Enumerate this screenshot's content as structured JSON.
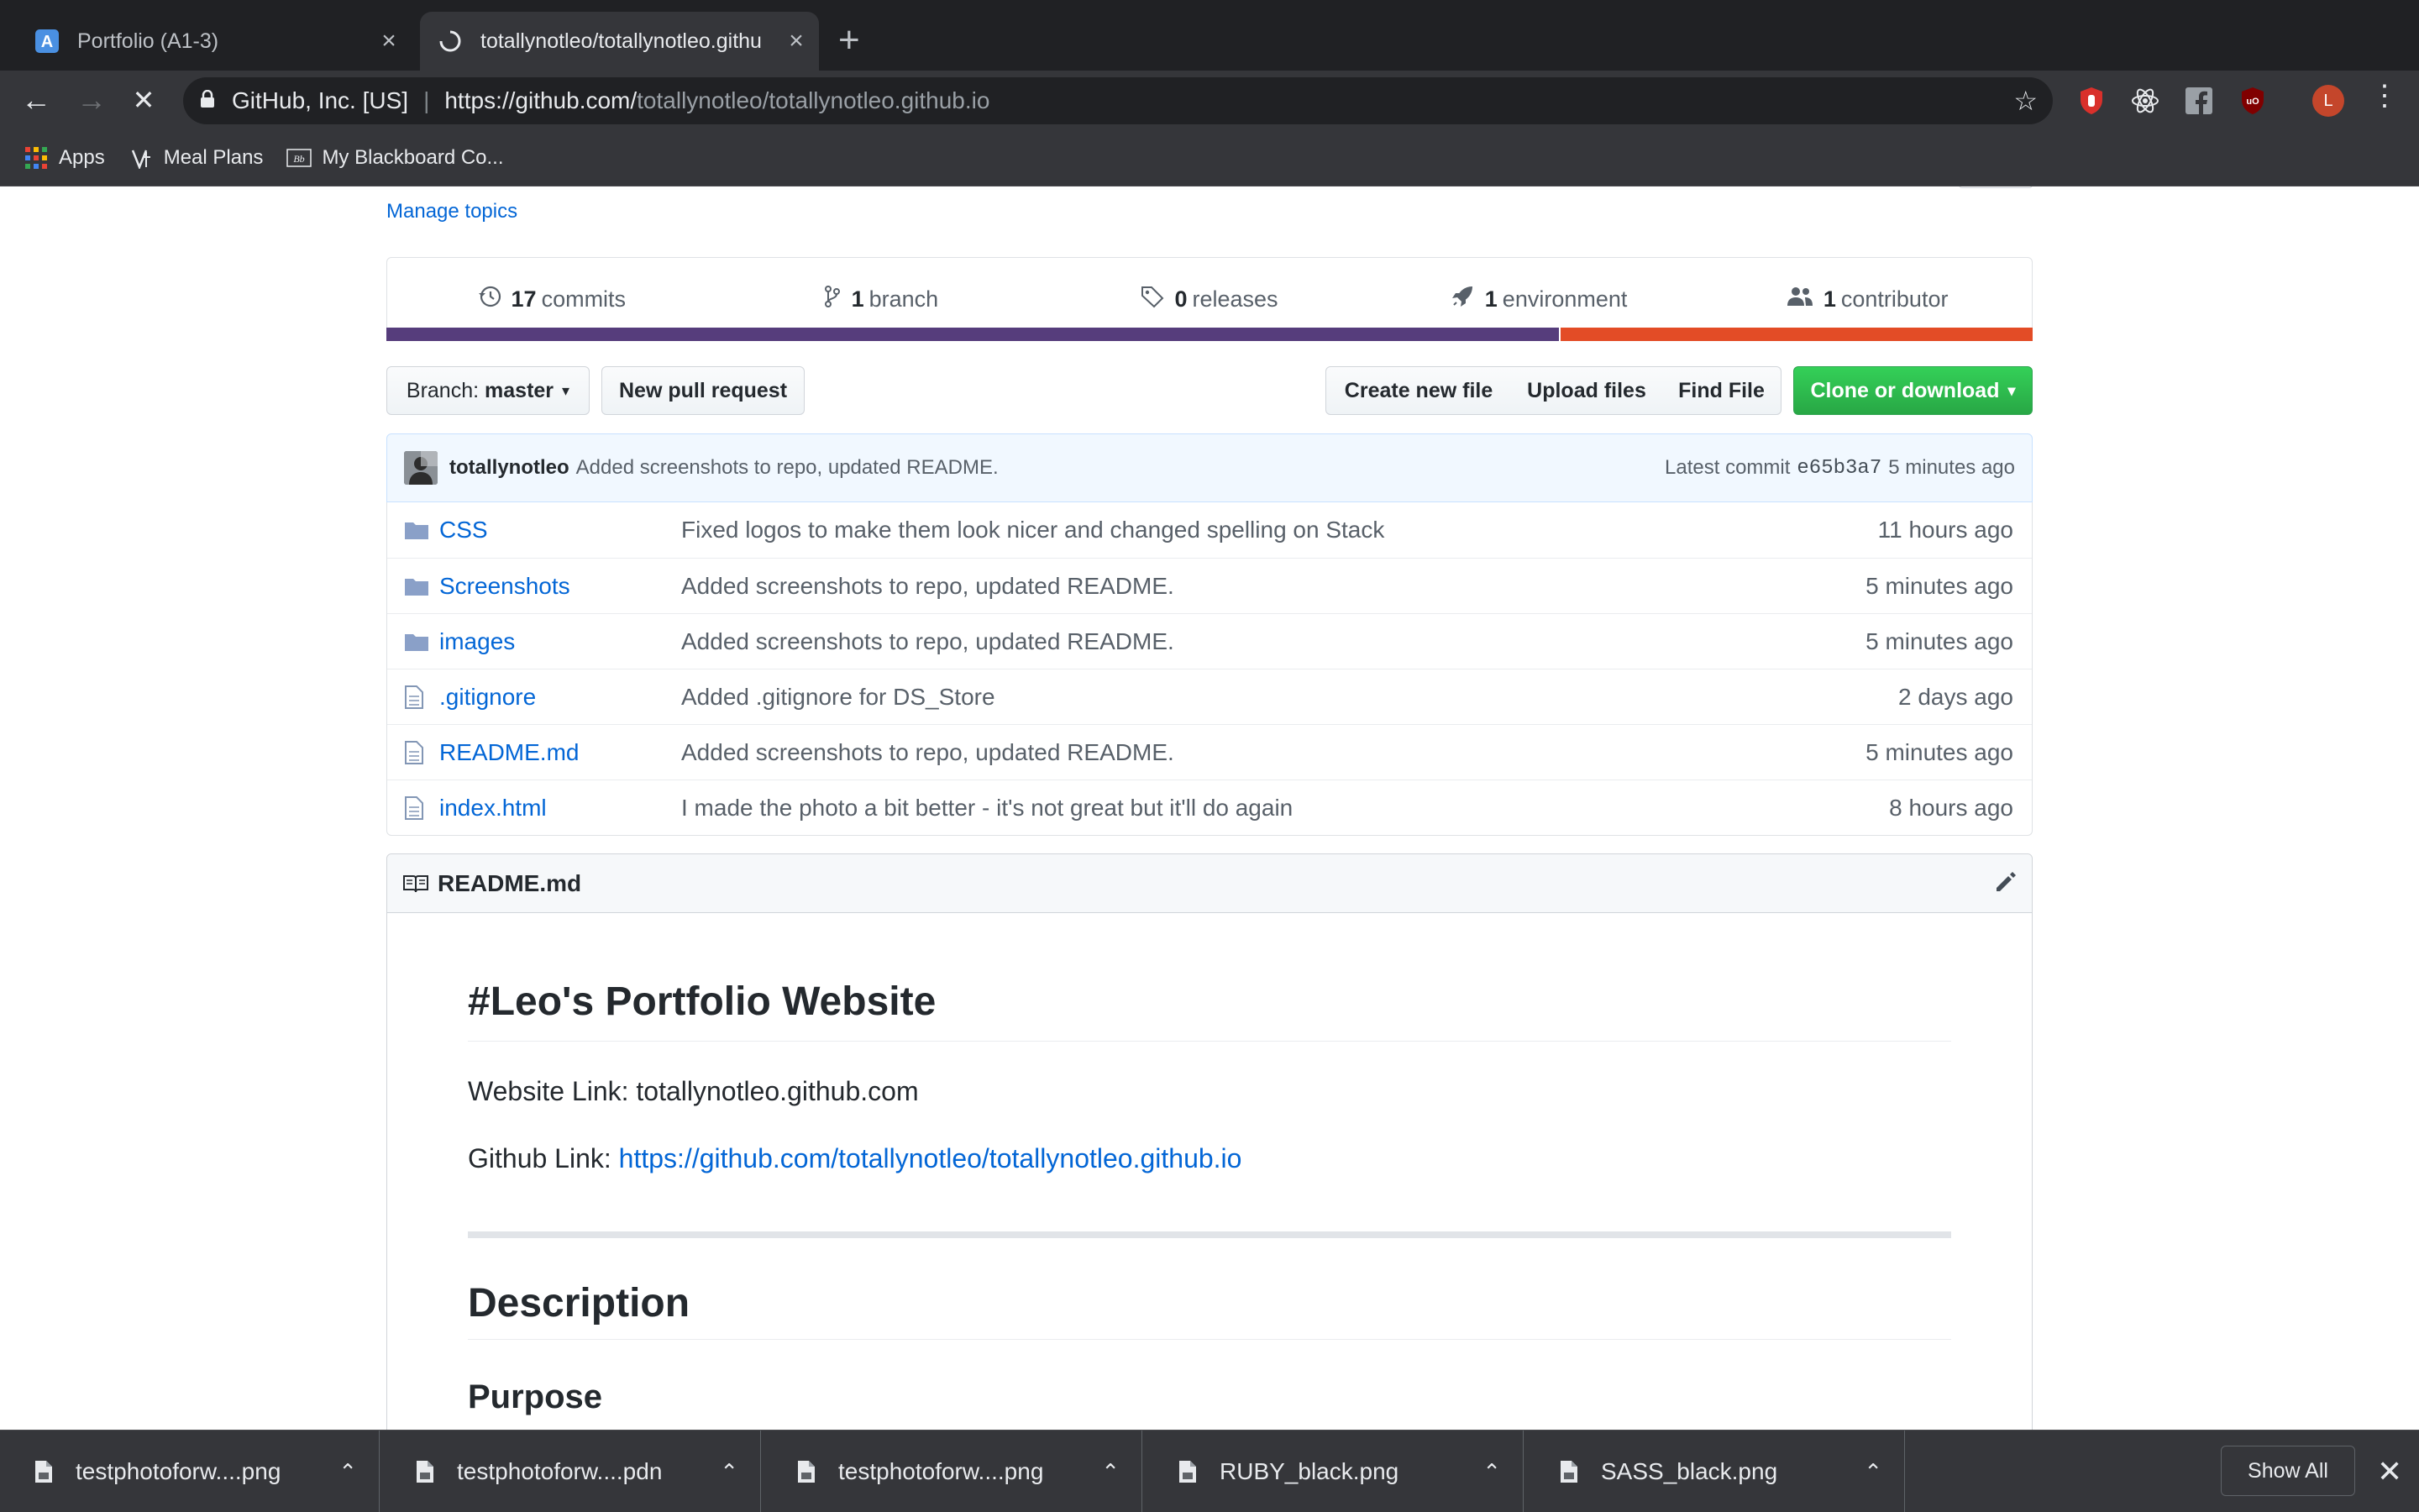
{
  "browser": {
    "tabs": [
      {
        "title": "Portfolio (A1-3)",
        "close": "×"
      },
      {
        "title": "totallynotleo/totallynotleo.githu",
        "close": "×"
      }
    ],
    "new_tab": "+",
    "back": "←",
    "forward": "→",
    "stop": "✕",
    "site_identity": "GitHub, Inc. [US]",
    "url_host": "https://github.com/",
    "url_path": "totallynotleo/totallynotleo.github.io",
    "star": "☆",
    "avatar_letter": "L",
    "menu": "⋮",
    "bookmarks": [
      {
        "label": "Apps"
      },
      {
        "label": "Meal Plans"
      },
      {
        "label": "My Blackboard Co..."
      }
    ]
  },
  "repo": {
    "manage_topics": "Manage topics",
    "stats": [
      {
        "count": "17",
        "label": "commits",
        "icon": "history-icon"
      },
      {
        "count": "1",
        "label": "branch",
        "icon": "branch-icon"
      },
      {
        "count": "0",
        "label": "releases",
        "icon": "tag-icon"
      },
      {
        "count": "1",
        "label": "environment",
        "icon": "rocket-icon"
      },
      {
        "count": "1",
        "label": "contributor",
        "icon": "people-icon"
      }
    ],
    "languages": [
      {
        "color": "#563d7c",
        "fraction": 0.712
      },
      {
        "color": "#e34c26",
        "fraction": 0.288
      }
    ],
    "branch_label": "Branch:",
    "branch_name": "master",
    "new_pull_request": "New pull request",
    "create_new_file": "Create new file",
    "upload_files": "Upload files",
    "find_file": "Find File",
    "clone_or_download": "Clone or download",
    "latest_commit": {
      "author": "totallynotleo",
      "message": "Added screenshots to repo, updated README.",
      "prefix": "Latest commit",
      "sha": "e65b3a7",
      "age": "5 minutes ago"
    },
    "files": [
      {
        "type": "folder",
        "name": "CSS",
        "message": "Fixed logos to make them look nicer and changed spelling on Stack",
        "age": "11 hours ago"
      },
      {
        "type": "folder",
        "name": "Screenshots",
        "message": "Added screenshots to repo, updated README.",
        "age": "5 minutes ago"
      },
      {
        "type": "folder",
        "name": "images",
        "message": "Added screenshots to repo, updated README.",
        "age": "5 minutes ago"
      },
      {
        "type": "file",
        "name": ".gitignore",
        "message": "Added .gitignore for DS_Store",
        "age": "2 days ago"
      },
      {
        "type": "file",
        "name": "README.md",
        "message": "Added screenshots to repo, updated README.",
        "age": "5 minutes ago"
      },
      {
        "type": "file",
        "name": "index.html",
        "message": "I made the photo a bit better - it's not great but it'll do again",
        "age": "8 hours ago"
      }
    ],
    "readme": {
      "header": "README.md",
      "h1": "#Leo's Portfolio Website",
      "website_link": "Website Link: totallynotleo.github.com",
      "github_label": "Github Link: ",
      "github_url": "https://github.com/totallynotleo/totallynotleo.github.io",
      "h2": "Description",
      "h3": "Purpose"
    }
  },
  "downloads": {
    "items": [
      {
        "name": "testphotoforw....png"
      },
      {
        "name": "testphotoforw....pdn"
      },
      {
        "name": "testphotoforw....png"
      },
      {
        "name": "RUBY_black.png"
      },
      {
        "name": "SASS_black.png"
      }
    ],
    "show_all": "Show All",
    "close": "✕"
  }
}
